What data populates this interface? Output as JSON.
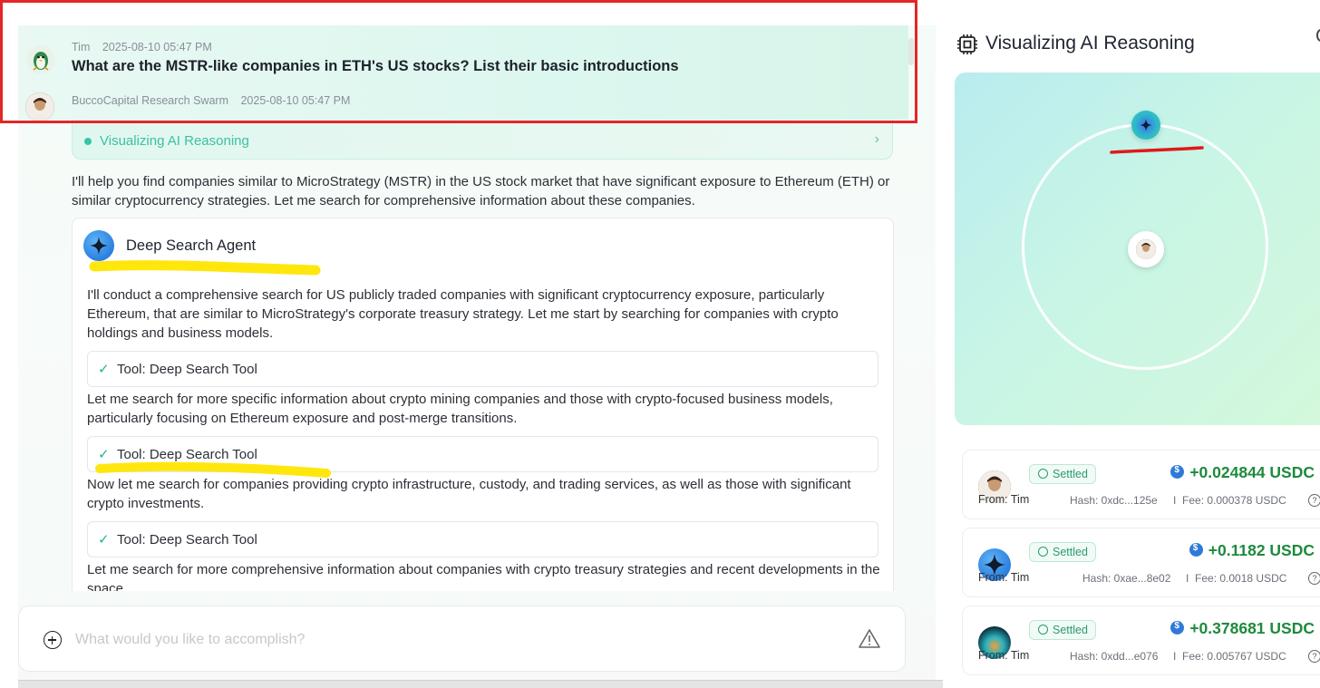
{
  "user_message": {
    "name": "Tim",
    "time": "2025-08-10 05:47 PM",
    "question": "What are the MSTR-like companies in ETH's US stocks? List their basic introductions"
  },
  "bot_message": {
    "name": "BuccoCapital Research Swarm",
    "time": "2025-08-10 05:47 PM",
    "reasoning_label": "Visualizing AI Reasoning",
    "intro": "I'll help you find companies similar to MicroStrategy (MSTR) in the US stock market that have significant exposure to Ethereum (ETH) or similar cryptocurrency strategies. Let me search for comprehensive information about these companies."
  },
  "agent_card": {
    "title": "Deep Search Agent",
    "paragraphs": [
      "I'll conduct a comprehensive search for US publicly traded companies with significant cryptocurrency exposure, particularly Ethereum, that are similar to MicroStrategy's corporate treasury strategy. Let me start by searching for companies with crypto holdings and business models.",
      "Let me search for more specific information about crypto mining companies and those with crypto-focused business models, particularly focusing on Ethereum exposure and post-merge transitions.",
      "Now let me search for companies providing crypto infrastructure, custody, and trading services, as well as those with significant crypto investments.",
      "Let me search for more comprehensive information about companies with crypto treasury strategies and recent developments in the space."
    ],
    "tools": [
      "Tool: Deep Search Tool",
      "Tool: Deep Search Tool",
      "Tool: Deep Search Tool"
    ]
  },
  "input": {
    "placeholder": "What would you like to accomplish?"
  },
  "right_panel": {
    "title": "Visualizing AI Reasoning",
    "transactions": [
      {
        "status": "Settled",
        "amount": "+0.024844 USDC",
        "from_label": "From:",
        "from": "Tim",
        "hash": "Hash: 0xdc...125e",
        "fee": "Fee: 0.000378 USDC",
        "avatar": "person"
      },
      {
        "status": "Settled",
        "amount": "+0.1182 USDC",
        "from_label": "From:",
        "from": "Tim",
        "hash": "Hash: 0xae...8e02",
        "fee": "Fee: 0.0018 USDC",
        "avatar": "agent"
      },
      {
        "status": "Settled",
        "amount": "+0.378681 USDC",
        "from_label": "From:",
        "from": "Tim",
        "hash": "Hash: 0xdd...e076",
        "fee": "Fee: 0.005767 USDC",
        "avatar": "orb"
      }
    ]
  },
  "colors": {
    "accent": "#34c6a8",
    "amount_green": "#1d8a3c",
    "highlight_box": "#e32626",
    "marker_yellow": "#ffe600",
    "marker_red": "#e01818"
  },
  "icons": [
    "user-avatar",
    "bot-avatar",
    "sparkle-icon",
    "check-icon",
    "plus-icon",
    "warning-icon",
    "chip-icon",
    "usdc-coin-icon",
    "check-circle-icon",
    "help-icon"
  ]
}
